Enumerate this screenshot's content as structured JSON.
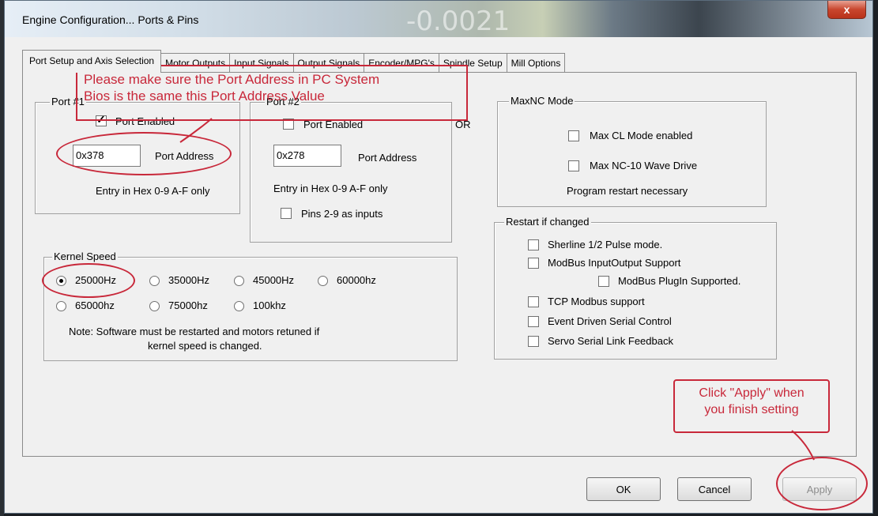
{
  "window": {
    "title": "Engine Configuration... Ports & Pins",
    "background_digits": "-0.0021",
    "close_symbol": "x"
  },
  "tabs": [
    "Port Setup and Axis Selection",
    "Motor Outputs",
    "Input Signals",
    "Output Signals",
    "Encoder/MPG's",
    "Spindle Setup",
    "Mill Options"
  ],
  "port1": {
    "legend": "Port #1",
    "enabled_label": "Port Enabled",
    "enabled": true,
    "address_value": "0x378",
    "address_label": "Port Address",
    "hint": "Entry in Hex 0-9 A-F only"
  },
  "port2": {
    "legend": "Port #2",
    "enabled_label": "Port Enabled",
    "enabled": false,
    "address_value": "0x278",
    "address_label": "Port Address",
    "hint": "Entry in Hex 0-9 A-F only",
    "pins_label": "Pins 2-9 as inputs",
    "pins_checked": false
  },
  "or_label": "OR",
  "maxnc": {
    "legend": "MaxNC Mode",
    "max_cl_label": "Max CL Mode enabled",
    "max_nc10_label": "Max NC-10 Wave Drive",
    "note": "Program restart necessary"
  },
  "restart": {
    "legend": "Restart if changed",
    "items": [
      "Sherline 1/2 Pulse mode.",
      "ModBus InputOutput Support",
      "ModBus PlugIn Supported.",
      "TCP Modbus support",
      "Event Driven Serial Control",
      "Servo Serial Link Feedback"
    ]
  },
  "kernel": {
    "legend": "Kernel Speed",
    "options": [
      "25000Hz",
      "35000Hz",
      "45000Hz",
      "60000hz",
      "65000hz",
      "75000hz",
      "100khz"
    ],
    "selected": "25000Hz",
    "note_line1": "Note: Software must be restarted and motors retuned if",
    "note_line2": "kernel speed is changed."
  },
  "buttons": {
    "ok": "OK",
    "cancel": "Cancel",
    "apply": "Apply"
  },
  "annotations": {
    "port_note_line1": "Please make sure the Port Address in PC System",
    "port_note_line2": "Bios is the same this Port Address Value",
    "apply_note_line1": "Click \"Apply\" when",
    "apply_note_line2": "you finish setting"
  },
  "colors": {
    "annotation": "#c8283a",
    "dialog_bg": "#f0f0f0"
  }
}
